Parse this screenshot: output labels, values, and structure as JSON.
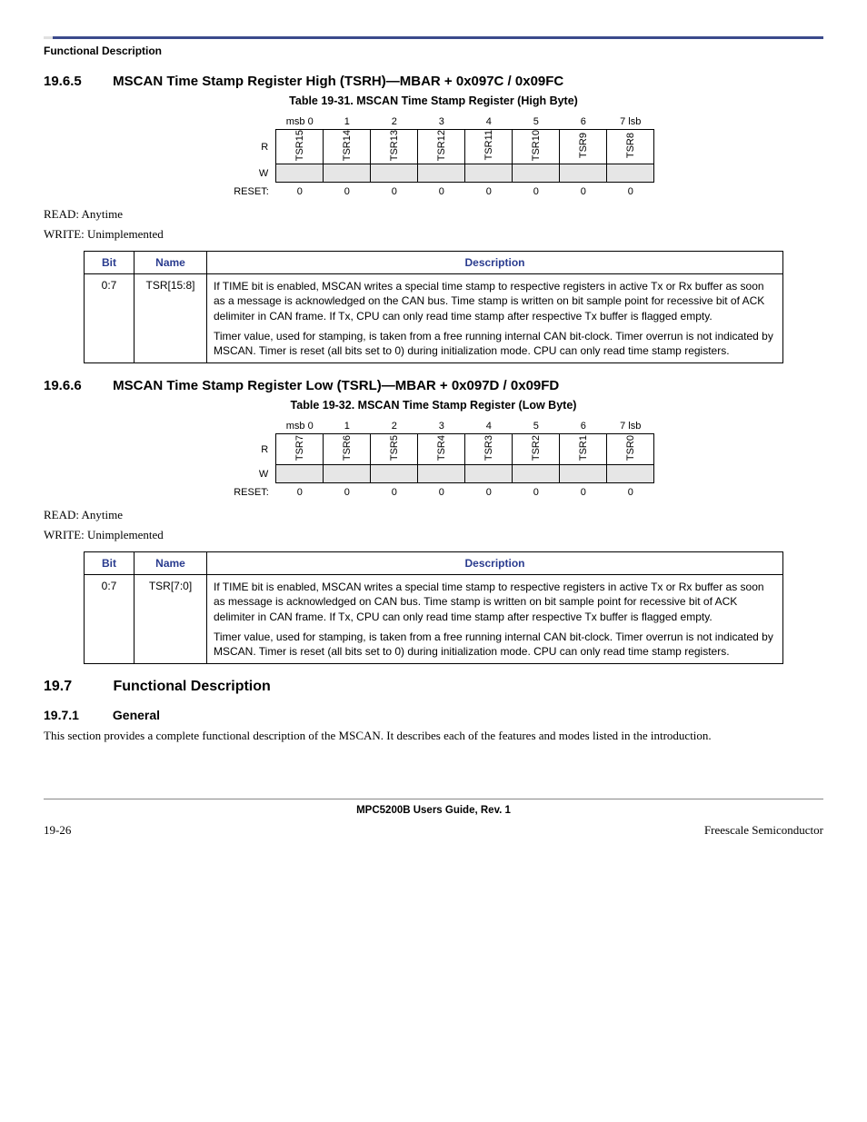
{
  "header": {
    "title": "Functional Description"
  },
  "sec1": {
    "num": "19.6.5",
    "title": "MSCAN Time Stamp Register High (TSRH)—MBAR + 0x097C / 0x09FC",
    "table_caption": "Table 19-31. MSCAN Time Stamp Register (High Byte)",
    "bit_header": [
      "msb 0",
      "1",
      "2",
      "3",
      "4",
      "5",
      "6",
      "7 lsb"
    ],
    "r_label": "R",
    "w_label": "W",
    "reset_label": "RESET:",
    "bits": [
      "TSR15",
      "TSR14",
      "TSR13",
      "TSR12",
      "TSR11",
      "TSR10",
      "TSR9",
      "TSR8"
    ],
    "reset": [
      "0",
      "0",
      "0",
      "0",
      "0",
      "0",
      "0",
      "0"
    ],
    "read_note": "READ: Anytime",
    "write_note": "WRITE: Unimplemented",
    "desc": {
      "headers": [
        "Bit",
        "Name",
        "Description"
      ],
      "bit": "0:7",
      "name": "TSR[15:8]",
      "p1": "If TIME bit is enabled, MSCAN writes a special time stamp to respective registers in active Tx or Rx buffer as soon as a message is acknowledged on the CAN bus. Time stamp is written on bit sample point for recessive bit of ACK delimiter in CAN frame. If Tx, CPU can only read time stamp after respective Tx buffer is flagged empty.",
      "p2": "Timer value, used for stamping, is taken from a free running internal CAN bit-clock. Timer overrun is not indicated by MSCAN. Timer is reset (all bits set to 0) during initialization mode. CPU can only read time stamp registers."
    }
  },
  "sec2": {
    "num": "19.6.6",
    "title": "MSCAN Time Stamp Register Low (TSRL)—MBAR + 0x097D / 0x09FD",
    "table_caption": "Table 19-32. MSCAN Time Stamp Register (Low Byte)",
    "bit_header": [
      "msb 0",
      "1",
      "2",
      "3",
      "4",
      "5",
      "6",
      "7 lsb"
    ],
    "r_label": "R",
    "w_label": "W",
    "reset_label": "RESET:",
    "bits": [
      "TSR7",
      "TSR6",
      "TSR5",
      "TSR4",
      "TSR3",
      "TSR2",
      "TSR1",
      "TSR0"
    ],
    "reset": [
      "0",
      "0",
      "0",
      "0",
      "0",
      "0",
      "0",
      "0"
    ],
    "read_note": "READ: Anytime",
    "write_note": "WRITE: Unimplemented",
    "desc": {
      "headers": [
        "Bit",
        "Name",
        "Description"
      ],
      "bit": "0:7",
      "name": "TSR[7:0]",
      "p1": "If TIME bit is enabled, MSCAN writes a special time stamp to respective registers in active Tx or Rx buffer as soon as message is acknowledged on CAN bus. Time stamp is written on bit sample point for recessive bit of ACK delimiter in CAN frame. If Tx, CPU can only read time stamp after respective Tx buffer is flagged empty.",
      "p2": "Timer value, used for stamping, is taken from a free running internal CAN bit-clock. Timer overrun is not indicated by MSCAN. Timer is reset (all bits set to 0) during initialization mode. CPU can only read time stamp registers."
    }
  },
  "sec3": {
    "num": "19.7",
    "title": "Functional Description",
    "sub_num": "19.7.1",
    "sub_title": "General",
    "body": "This section provides a complete functional description of the MSCAN. It describes each of the features and modes listed in the introduction."
  },
  "footer": {
    "center": "MPC5200B Users Guide, Rev. 1",
    "left": "19-26",
    "right": "Freescale Semiconductor"
  }
}
